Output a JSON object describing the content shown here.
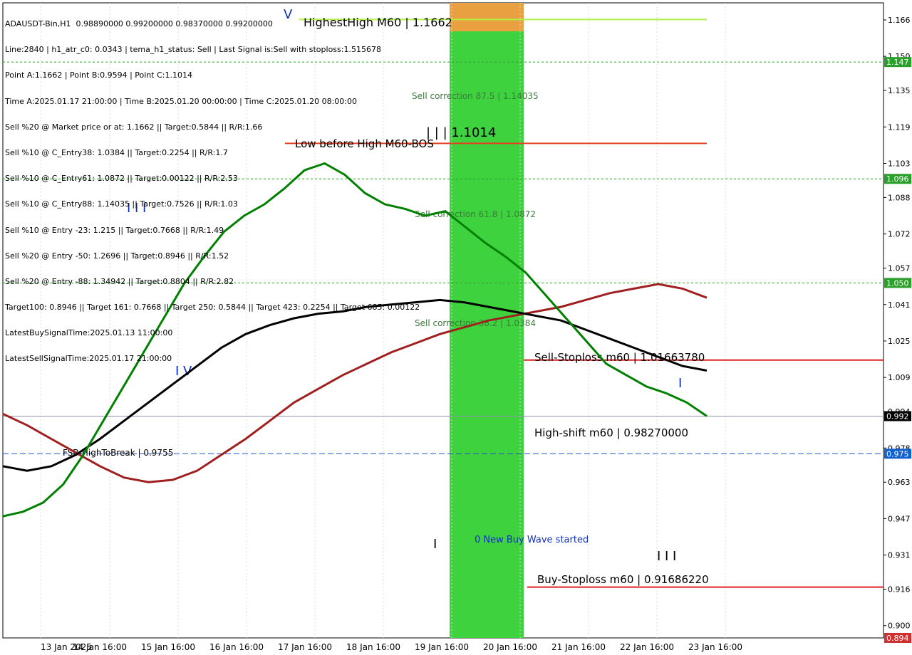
{
  "header_lines": [
    "ADAUSDT-Bin,H1  0.98890000 0.99200000 0.98370000 0.99200000",
    "Line:2840 | h1_atr_c0: 0.0343 | tema_h1_status: Sell | Last Signal is:Sell with stoploss:1.515678",
    "Point A:1.1662 | Point B:0.9594 | Point C:1.1014",
    "Time A:2025.01.17 21:00:00 | Time B:2025.01.20 00:00:00 | Time C:2025.01.20 08:00:00",
    "Sell %20 @ Market price or at: 1.1662 || Target:0.5844 || R/R:1.66",
    "Sell %10 @ C_Entry38: 1.0384 || Target:0.2254 || R/R:1.7",
    "Sell %10 @ C_Entry61: 1.0872 || Target:0.00122 || R/R:2.53",
    "Sell %10 @ C_Entry88: 1.14035 || Target:0.7526 || R/R:1.03",
    "Sell %10 @ Entry -23: 1.215 || Target:0.7668 || R/R:1.49",
    "Sell %20 @ Entry -50: 1.2696 || Target:0.8946 || R/R:1.52",
    "Sell %20 @ Entry -88: 1.34942 || Target:0.8804 || R/R:2.82",
    "Target100: 0.8946 || Target 161: 0.7668 || Target 250: 0.5844 || Target 423: 0.2254 || Target 685: 0.00122",
    "LatestBuySignalTime:2025.01.13 11:00:00",
    "LatestSellSignalTime:2025.01.17 21:00:00"
  ],
  "colors": {
    "up": "#00a000",
    "down": "#000000",
    "ma_green": "#008000",
    "ma_black": "#000000",
    "ma_red": "#a02020",
    "line_red": "#e03020",
    "green_zone": "#3fd23f",
    "orange_zone": "#e8a040"
  },
  "chart_data": {
    "type": "line",
    "title": "ADAUSDT-Bin,H1",
    "ylim": [
      0.8946,
      1.1735
    ],
    "y_ticks": [
      "1.166",
      "1.150",
      "1.135",
      "1.119",
      "1.103",
      "1.088",
      "1.072",
      "1.057",
      "1.041",
      "1.025",
      "1.009",
      "0.994",
      "0.978",
      "0.963",
      "0.947",
      "0.931",
      "0.916",
      "0.900"
    ],
    "x_ticks": [
      "13 Jan 2025",
      "14 Jan 16:00",
      "15 Jan 16:00",
      "16 Jan 16:00",
      "17 Jan 16:00",
      "18 Jan 16:00",
      "19 Jan 16:00",
      "20 Jan 16:00",
      "21 Jan 16:00",
      "22 Jan 16:00",
      "23 Jan 16:00"
    ],
    "price_badges": [
      {
        "value": "1.147",
        "y": 1.1475,
        "color": "#2aa02a"
      },
      {
        "value": "1.096",
        "y": 1.0962,
        "color": "#2aa02a"
      },
      {
        "value": "1.050",
        "y": 1.0505,
        "color": "#2aa02a"
      },
      {
        "value": "0.992",
        "y": 0.992,
        "color": "#000000"
      },
      {
        "value": "0.975",
        "y": 0.9755,
        "color": "#1060d0"
      },
      {
        "value": "0.894",
        "y": 0.8946,
        "color": "#d03030"
      }
    ],
    "horizontal_lines": [
      {
        "label": "HighestHigh   M60 | 1.1662",
        "y": 1.1662,
        "color": "#b0f040"
      },
      {
        "label": "Low before High   M60-BOS",
        "y": 1.1118,
        "color": "#e04020"
      },
      {
        "label": "Sell-Stoploss m60 | 1.01663780",
        "y": 1.0166,
        "color": "#e02020"
      },
      {
        "label": "High-shift m60 | 0.98270000",
        "y": 0.9827,
        "color": "#ffffff"
      },
      {
        "label": "Buy-Stoploss m60 | 0.91686220",
        "y": 0.9169,
        "color": "#e02020"
      },
      {
        "label": "FSB-HighToBreak | 0.9755",
        "y": 0.9755,
        "color": "#2050d0"
      }
    ],
    "annotations": [
      "Sell correction 87.5 | 1.14035",
      "Sell correction 61.8 | 1.0872",
      "Sell correction 38.2 | 1.0384",
      "| | | 1.1014",
      "0 New Buy Wave started",
      "I I I",
      "I V",
      "V",
      "I",
      "I I I",
      "I"
    ],
    "series_ma_green": [
      0.948,
      0.95,
      0.954,
      0.962,
      0.975,
      0.99,
      1.005,
      1.02,
      1.035,
      1.05,
      1.062,
      1.073,
      1.08,
      1.085,
      1.092,
      1.1,
      1.103,
      1.098,
      1.09,
      1.085,
      1.083,
      1.08,
      1.082,
      1.075,
      1.068,
      1.062,
      1.055,
      1.045,
      1.035,
      1.025,
      1.015,
      1.01,
      1.005,
      1.002,
      0.998,
      0.992
    ],
    "series_ma_black": [
      0.97,
      0.968,
      0.97,
      0.975,
      0.982,
      0.99,
      0.998,
      1.006,
      1.014,
      1.022,
      1.028,
      1.032,
      1.035,
      1.037,
      1.038,
      1.04,
      1.041,
      1.042,
      1.043,
      1.042,
      1.04,
      1.038,
      1.036,
      1.034,
      1.03,
      1.026,
      1.022,
      1.018,
      1.014,
      1.012
    ],
    "series_ma_red": [
      0.993,
      0.988,
      0.982,
      0.976,
      0.97,
      0.965,
      0.963,
      0.964,
      0.968,
      0.975,
      0.982,
      0.99,
      0.998,
      1.004,
      1.01,
      1.015,
      1.02,
      1.024,
      1.028,
      1.031,
      1.034,
      1.036,
      1.038,
      1.04,
      1.043,
      1.046,
      1.048,
      1.05,
      1.048,
      1.044
    ]
  }
}
